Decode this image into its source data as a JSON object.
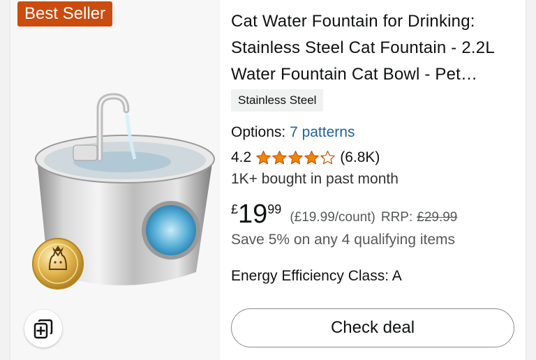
{
  "badge": {
    "label": "Best Seller"
  },
  "product": {
    "title": "Cat Water Fountain for Drinking: Stainless Steel Cat Fountain - 2.2L Water Fountain Cat Bowl - Pet…",
    "variant": "Stainless Steel",
    "options_label": "Options:",
    "options_link": "7 patterns",
    "rating_value": "4.2",
    "rating_stars": 4.2,
    "rating_count": "(6.8K)",
    "bought": "1K+ bought in past month",
    "price": {
      "currency": "£",
      "whole": "19",
      "fraction": "99",
      "unit_price": "(£19.99/count)",
      "rrp_label": "RRP:",
      "rrp_value": "£29.99"
    },
    "savings": "Save 5% on any 4 qualifying items",
    "energy": "Energy Efficiency Class: A",
    "cta": "Check deal"
  },
  "icons": {
    "compare": "compare-add-icon",
    "seal": "cat-seal-icon",
    "star": "star-icon"
  },
  "colors": {
    "badge_bg": "#cc4b0e",
    "star": "#f08804",
    "link": "#2162a1"
  }
}
